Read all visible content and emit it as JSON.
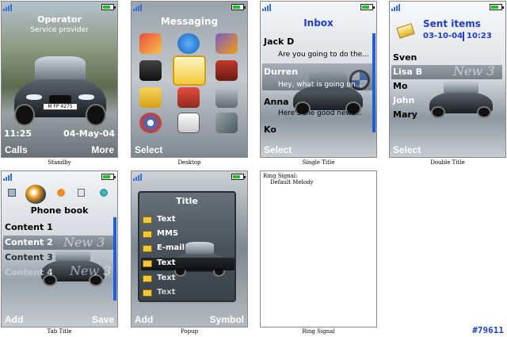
{
  "colors": {
    "accent_blue": "#1f3ec9",
    "signal": "#3a6fd8",
    "battery": "#1fc21f",
    "scroll": "#1f5fd6"
  },
  "standby": {
    "operator": "Operator",
    "service_provider": "Service provider",
    "plate": "M FP 4275",
    "time": "11:25",
    "date": "04-May-04",
    "soft_left": "Calls",
    "soft_right": "More",
    "caption": "Standby"
  },
  "desktop": {
    "title": "Messaging",
    "icons": [
      "contacts-icon",
      "internet-icon",
      "entertainment-icon",
      "camera-icon",
      "messaging-icon",
      "media-icon",
      "file-manager-icon",
      "organizer-icon",
      "settings-icon",
      "connectivity-icon",
      "calendar-icon",
      "tools-icon"
    ],
    "soft_left": "Select",
    "caption": "Desktop"
  },
  "single_title": {
    "title": "Inbox",
    "items": [
      {
        "name": "Jack D",
        "preview": "Are you going to do the..."
      },
      {
        "name": "Durren",
        "preview": "Hey, what is going on..."
      },
      {
        "name": "Anna",
        "preview": "Here's the good news..."
      },
      {
        "name": "Ko",
        "preview": ""
      }
    ],
    "soft_left": "Select",
    "caption": "Single Title"
  },
  "double_title": {
    "title": "Sent items",
    "date": "03-10-04",
    "time": "10:23",
    "items": [
      "Sven",
      "Lisa B",
      "Mo",
      "John",
      "Mary"
    ],
    "watermark": "New 3",
    "soft_left": "Select",
    "caption": "Double Title"
  },
  "tab_title": {
    "title": "Phone book",
    "items": [
      "Content 1",
      "Content 2",
      "Content 3",
      "Content 4"
    ],
    "watermark": "New 3",
    "soft_left": "Add",
    "soft_right": "Save",
    "caption": "Tab Title"
  },
  "popup": {
    "title": "Title",
    "items": [
      "Text",
      "MMS",
      "E-mail",
      "Text",
      "Text",
      "Text"
    ],
    "soft_left": "Add",
    "soft_right": "Symbol",
    "caption": "Popup"
  },
  "ring_signal": {
    "label": "Ring Signal:",
    "value": "Default Melody",
    "caption": "Ring Signal"
  },
  "image_id": "#79611"
}
